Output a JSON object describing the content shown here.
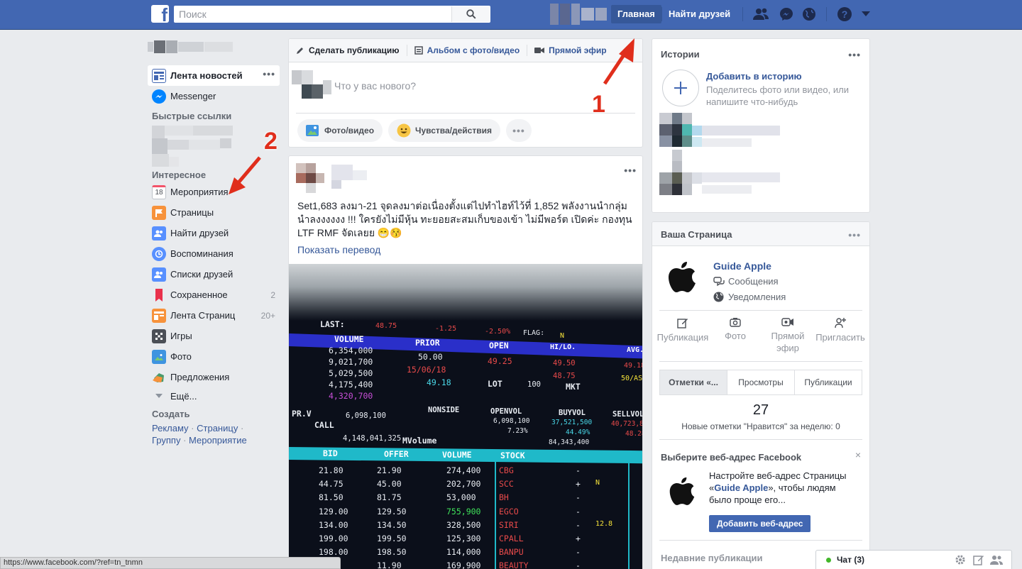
{
  "topbar": {
    "search_placeholder": "Поиск",
    "home_label": "Главная",
    "find_friends_label": "Найти друзей"
  },
  "left": {
    "nav": [
      {
        "label": "Лента новостей",
        "icon": "news-feed-icon"
      },
      {
        "label": "Messenger",
        "icon": "messenger-icon"
      }
    ],
    "quick_links_title": "Быстрые ссылки",
    "explore_title": "Интересное",
    "explore": [
      {
        "label": "Мероприятия",
        "icon": "calendar-icon",
        "count": ""
      },
      {
        "label": "Страницы",
        "icon": "flag-icon",
        "count": ""
      },
      {
        "label": "Найти друзей",
        "icon": "friends-icon",
        "count": ""
      },
      {
        "label": "Воспоминания",
        "icon": "memories-icon",
        "count": ""
      },
      {
        "label": "Списки друзей",
        "icon": "friend-lists-icon",
        "count": ""
      },
      {
        "label": "Сохраненное",
        "icon": "bookmark-icon",
        "count": "2"
      },
      {
        "label": "Лента Страниц",
        "icon": "pages-feed-icon",
        "count": "20+"
      },
      {
        "label": "Игры",
        "icon": "games-icon",
        "count": ""
      },
      {
        "label": "Фото",
        "icon": "photo-icon",
        "count": ""
      },
      {
        "label": "Предложения",
        "icon": "offers-icon",
        "count": ""
      }
    ],
    "more_label": "Ещё...",
    "create_title": "Создать",
    "create_links": [
      "Рекламу",
      "Страницу",
      "Группу",
      "Мероприятие"
    ]
  },
  "composer": {
    "tabs": [
      "Сделать публикацию",
      "Альбом с фото/видео",
      "Прямой эфир"
    ],
    "placeholder": "Что у вас нового?",
    "actions": [
      "Фото/видео",
      "Чувства/действия"
    ]
  },
  "post": {
    "text": "Set1,683 ลงมา-21 จุดลงมาต่อเนื่องตั้งแต่ไปทำไฮท์ไว้ที่ 1,852 พลังงานนำกลุ่ม นำลงงงงงง !!! ใครยังไม่มีหุ้น ทะยอยสะสมเก็บของเข้า ไม่มีพอร์ต เปิดค่ะ กองทุน LTF RMF จัดเลยย 😁😚",
    "translate_label": "Показать перевод"
  },
  "stock_screen": {
    "last_label": "LAST:",
    "last_values": [
      "48.75",
      "-1.25",
      "-2.50%"
    ],
    "flag_label": "FLAG:",
    "flag_value": "N",
    "headers1": [
      "VOLUME",
      "PRIOR",
      "OPEN",
      "HI/LO.",
      "AVG."
    ],
    "volume": [
      "6,354,000",
      "9,021,700",
      "5,029,500",
      "4,175,400",
      "4,320,700"
    ],
    "prior": [
      "50.00",
      "15/06/18"
    ],
    "prior_sub": "49.18",
    "open": "49.25",
    "hilo": [
      "49.50",
      "48.75"
    ],
    "avg": [
      "49.18",
      "50/ASO"
    ],
    "lot_label": "LOT",
    "lot_value": "100",
    "mkt_label": "MKT",
    "prv_label": "PR.V",
    "call_label": "CALL",
    "call_value": "6,098,100",
    "nonside_label": "NONSIDE",
    "openvol_label": "OPENVOL",
    "openvol_values": [
      "6,098,100",
      "7.23%"
    ],
    "buyvol_label": "BUYVOL",
    "buyvol_values": [
      "37,521,500",
      "44.49%",
      "84,343,400"
    ],
    "sellvol_label": "SELLVOL",
    "sellvol_values": [
      "40,723,800",
      "48.28%"
    ],
    "mvolume_value": "4,148,041,325",
    "mvolume_label": "MVolume",
    "headers2": [
      "BID",
      "OFFER",
      "VOLUME",
      "STOCK"
    ],
    "rows": [
      {
        "bid": "21.80",
        "offer": "21.90",
        "volume": "274,400",
        "stock": "CBG",
        "sign": "-",
        "flag": ""
      },
      {
        "bid": "44.75",
        "offer": "45.00",
        "volume": "202,700",
        "stock": "SCC",
        "sign": "+",
        "flag": "N"
      },
      {
        "bid": "81.50",
        "offer": "81.75",
        "volume": "53,000",
        "stock": "BH",
        "sign": "-",
        "flag": ""
      },
      {
        "bid": "129.00",
        "offer": "129.50",
        "volume": "755,900",
        "stock": "EGCO",
        "sign": "-",
        "flag": ""
      },
      {
        "bid": "134.00",
        "offer": "134.50",
        "volume": "328,500",
        "stock": "SIRI",
        "sign": "-",
        "flag": "12.8"
      },
      {
        "bid": "199.00",
        "offer": "199.50",
        "volume": "125,300",
        "stock": "CPALL",
        "sign": "+",
        "flag": ""
      },
      {
        "bid": "198.00",
        "offer": "198.50",
        "volume": "114,000",
        "stock": "BANPU",
        "sign": "-",
        "flag": ""
      },
      {
        "bid": "",
        "offer": "11.90",
        "volume": "169,900",
        "stock": "BEAUTY",
        "sign": "-",
        "flag": ""
      }
    ]
  },
  "stories": {
    "title": "Истории",
    "add_title": "Добавить в историю",
    "add_desc": "Поделитесь фото или видео, или напишите что-нибудь"
  },
  "your_page": {
    "title": "Ваша Страница",
    "page_name": "Guide Apple",
    "messages_label": "Сообщения",
    "notifications_label": "Уведомления",
    "actions": [
      "Публикация",
      "Фото",
      "Прямой эфир",
      "Пригласить"
    ],
    "tabs": [
      "Отметки «...",
      "Просмотры",
      "Публикации"
    ],
    "likes_count": "27",
    "likes_caption": "Новые отметки \"Нравится\" за неделю: 0",
    "web_title": "Выберите веб-адрес Facebook",
    "web_desc_pre": "Настройте веб-адрес Страницы «",
    "web_desc_name": "Guide Apple",
    "web_desc_post": "», чтобы людям было проще его...",
    "web_button": "Добавить веб-адрес",
    "recent_title": "Недавние публикации"
  },
  "status_url": "https://www.facebook.com/?ref=tn_tnmn",
  "chat": {
    "label": "Чат (3)"
  },
  "annotations": [
    "1",
    "2"
  ],
  "colors": {
    "brand": "#4267b2",
    "link": "#365899",
    "annotation": "#e02e1c"
  }
}
